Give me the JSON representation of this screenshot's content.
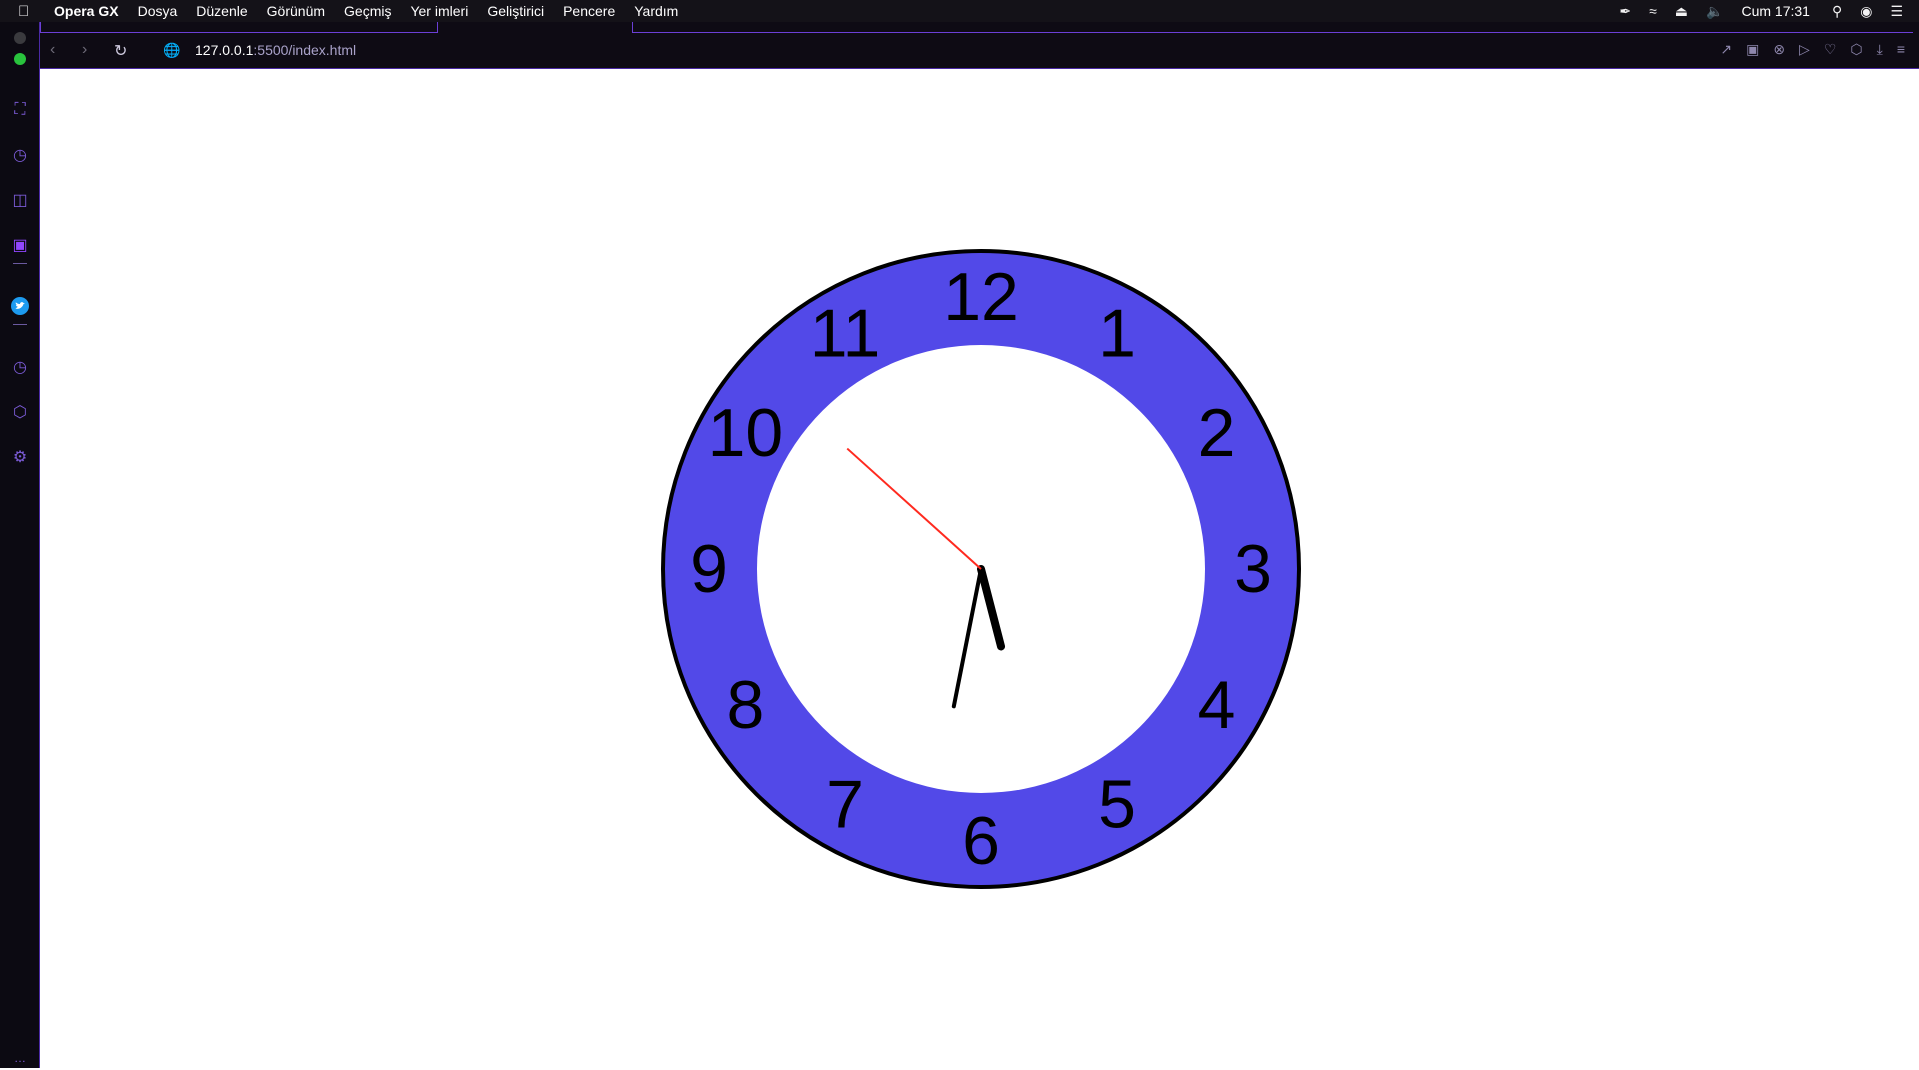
{
  "menubar": {
    "app_name": "Opera GX",
    "items": [
      "Dosya",
      "Düzenle",
      "Görünüm",
      "Geçmiş",
      "Yer imleri",
      "Geliştirici",
      "Pencere",
      "Yardım"
    ],
    "time": "Cum 17:31"
  },
  "address": {
    "host": "127.0.0.1",
    "path": ":5500/index.html"
  },
  "clock": {
    "numerals": [
      "12",
      "1",
      "2",
      "3",
      "4",
      "5",
      "6",
      "7",
      "8",
      "9",
      "10",
      "11"
    ],
    "time": {
      "hour": 5,
      "minute": 31,
      "second": 52
    },
    "ring_color": "#5249e8",
    "second_hand_color": "#ff2a1f"
  },
  "colors": {
    "accent": "#6b3fd6",
    "menubar_bg": "#141218",
    "browser_bg": "#0e0b14"
  }
}
